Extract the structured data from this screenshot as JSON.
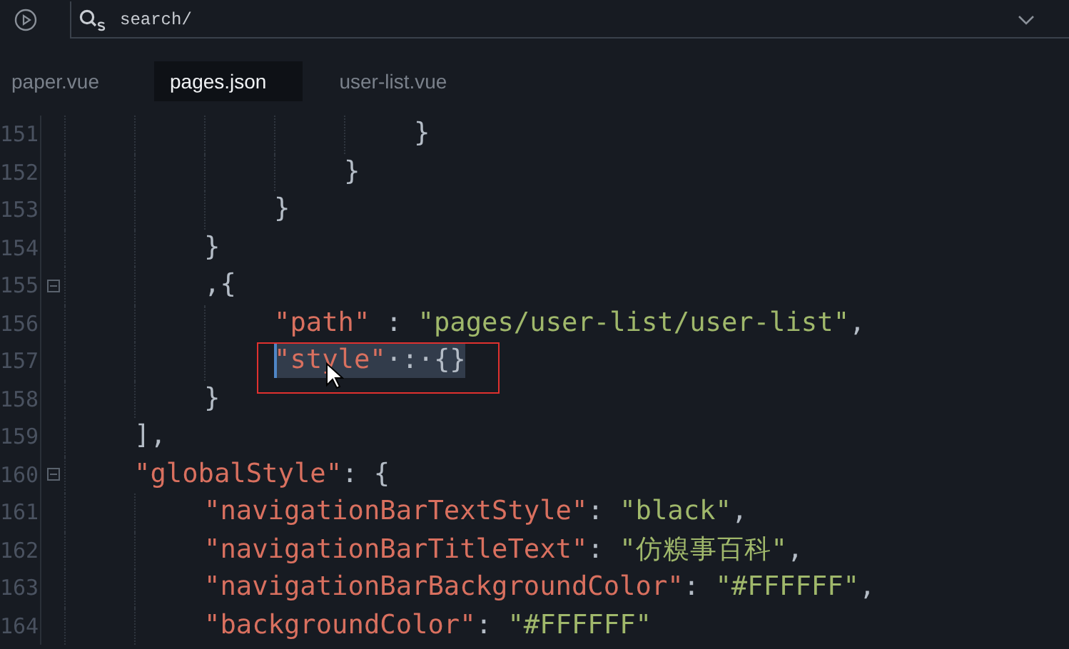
{
  "toolbar": {
    "search": {
      "value": "search/"
    }
  },
  "tabs": [
    {
      "label": "paper.vue",
      "selected": false
    },
    {
      "label": "pages.json",
      "selected": true
    },
    {
      "label": "user-list.vue",
      "selected": false
    }
  ],
  "code": [
    {
      "kind": "block",
      "children": [
        {
          "kind": "block",
          "children": [
            {
              "kind": "block",
              "children": [
                {
                  "kind": "block",
                  "children": [
                    {
                      "kind": "block",
                      "children": [
                        {
                          "kind": "line",
                          "number": "151",
                          "fold": false,
                          "selected": false,
                          "annotated": false,
                          "tokens": [
                            {
                              "kind": "punct",
                              "text": "}"
                            }
                          ]
                        }
                      ]
                    },
                    {
                      "kind": "line",
                      "number": "152",
                      "fold": false,
                      "selected": false,
                      "annotated": false,
                      "tokens": [
                        {
                          "kind": "punct",
                          "text": "}"
                        }
                      ]
                    }
                  ]
                },
                {
                  "kind": "line",
                  "number": "153",
                  "fold": false,
                  "selected": false,
                  "annotated": false,
                  "tokens": [
                    {
                      "kind": "punct",
                      "text": "}"
                    }
                  ]
                }
              ]
            },
            {
              "kind": "line",
              "number": "154",
              "fold": false,
              "selected": false,
              "annotated": false,
              "tokens": [
                {
                  "kind": "punct",
                  "text": "}"
                }
              ]
            },
            {
              "kind": "line",
              "number": "155",
              "fold": true,
              "selected": false,
              "annotated": false,
              "tokens": [
                {
                  "kind": "punct",
                  "text": ",{"
                }
              ]
            },
            {
              "kind": "block",
              "children": [
                {
                  "kind": "line",
                  "number": "156",
                  "fold": false,
                  "selected": false,
                  "annotated": false,
                  "tokens": [
                    {
                      "kind": "key",
                      "text": "\"path\""
                    },
                    {
                      "kind": "punct",
                      "text": " : "
                    },
                    {
                      "kind": "string",
                      "text": "\"pages/user-list/user-list\""
                    },
                    {
                      "kind": "punct",
                      "text": ","
                    }
                  ]
                },
                {
                  "kind": "line",
                  "number": "157",
                  "fold": false,
                  "selected": true,
                  "annotated": true,
                  "tokens": [
                    {
                      "kind": "key",
                      "text": "\"style\""
                    },
                    {
                      "kind": "punct",
                      "text": "·:·"
                    },
                    {
                      "kind": "punct",
                      "text": "{}"
                    }
                  ]
                }
              ]
            },
            {
              "kind": "line",
              "number": "158",
              "fold": false,
              "selected": false,
              "annotated": false,
              "tokens": [
                {
                  "kind": "punct",
                  "text": "}"
                }
              ]
            }
          ]
        },
        {
          "kind": "line",
          "number": "159",
          "fold": false,
          "selected": false,
          "annotated": false,
          "tokens": [
            {
              "kind": "punct",
              "text": "],"
            }
          ]
        },
        {
          "kind": "line",
          "number": "160",
          "fold": true,
          "selected": false,
          "annotated": false,
          "tokens": [
            {
              "kind": "key",
              "text": "\"globalStyle\""
            },
            {
              "kind": "punct",
              "text": ": {"
            }
          ]
        },
        {
          "kind": "block",
          "children": [
            {
              "kind": "line",
              "number": "161",
              "fold": false,
              "selected": false,
              "annotated": false,
              "tokens": [
                {
                  "kind": "key",
                  "text": "\"navigationBarTextStyle\""
                },
                {
                  "kind": "punct",
                  "text": ": "
                },
                {
                  "kind": "string",
                  "text": "\"black\""
                },
                {
                  "kind": "punct",
                  "text": ","
                }
              ]
            },
            {
              "kind": "line",
              "number": "162",
              "fold": false,
              "selected": false,
              "annotated": false,
              "tokens": [
                {
                  "kind": "key",
                  "text": "\"navigationBarTitleText\""
                },
                {
                  "kind": "punct",
                  "text": ": "
                },
                {
                  "kind": "string",
                  "text": "\"仿糗事百科\""
                },
                {
                  "kind": "punct",
                  "text": ","
                }
              ]
            },
            {
              "kind": "line",
              "number": "163",
              "fold": false,
              "selected": false,
              "annotated": false,
              "tokens": [
                {
                  "kind": "key",
                  "text": "\"navigationBarBackgroundColor\""
                },
                {
                  "kind": "punct",
                  "text": ": "
                },
                {
                  "kind": "string",
                  "text": "\"#FFFFFF\""
                },
                {
                  "kind": "punct",
                  "text": ","
                }
              ]
            },
            {
              "kind": "line",
              "number": "164",
              "fold": false,
              "selected": false,
              "annotated": false,
              "tokens": [
                {
                  "kind": "key",
                  "text": "\"backgroundColor\""
                },
                {
                  "kind": "punct",
                  "text": ": "
                },
                {
                  "kind": "string",
                  "text": "\"#FFFFFF\""
                }
              ]
            }
          ]
        }
      ]
    }
  ]
}
